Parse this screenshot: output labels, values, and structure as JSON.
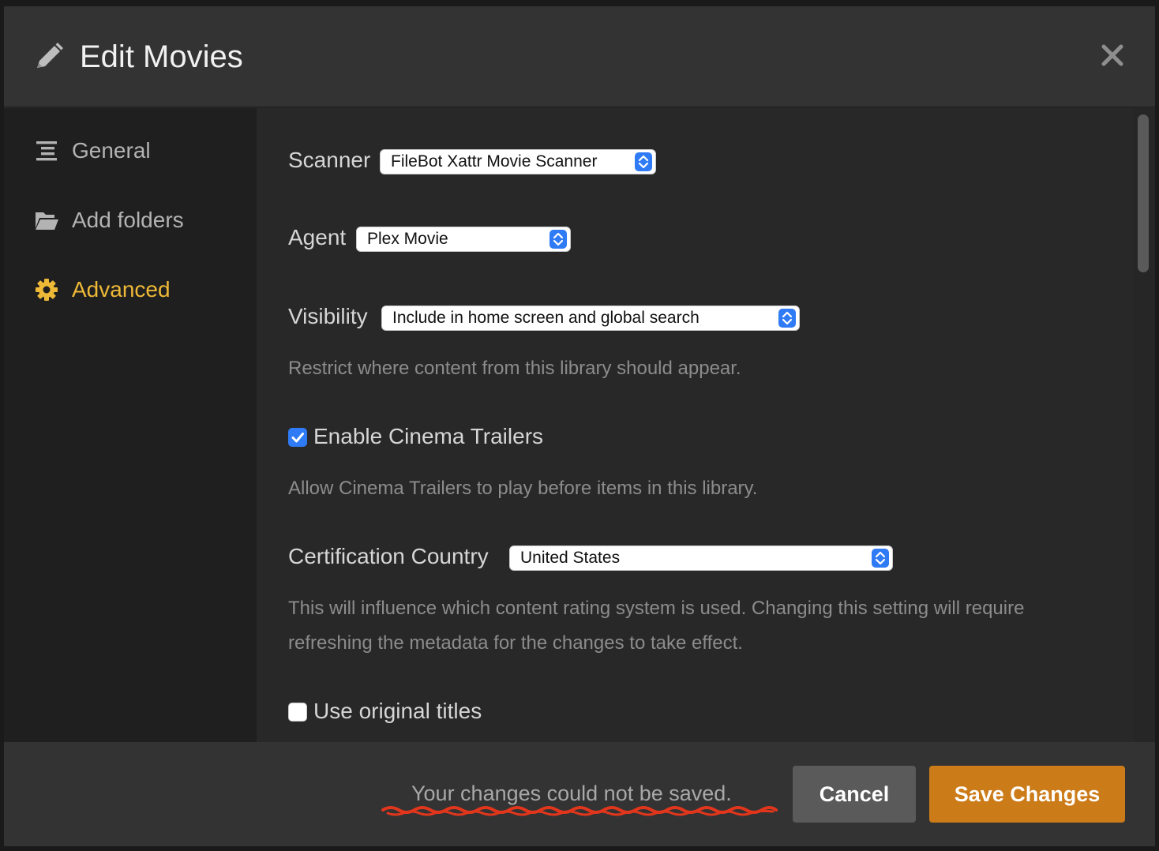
{
  "dialog": {
    "title": "Edit Movies",
    "title_icon": "pencil-icon",
    "close_icon": "close-icon"
  },
  "sidebar": {
    "items": [
      {
        "label": "General",
        "icon": "list-icon",
        "active": false
      },
      {
        "label": "Add folders",
        "icon": "folder-icon",
        "active": false
      },
      {
        "label": "Advanced",
        "icon": "gear-icon",
        "active": true
      }
    ]
  },
  "settings": {
    "scanner": {
      "label": "Scanner",
      "value": "FileBot Xattr Movie Scanner"
    },
    "agent": {
      "label": "Agent",
      "value": "Plex Movie"
    },
    "visibility": {
      "label": "Visibility",
      "value": "Include in home screen and global search",
      "help": "Restrict where content from this library should appear."
    },
    "cinema_trailers": {
      "label": "Enable Cinema Trailers",
      "checked": true,
      "help": "Allow Cinema Trailers to play before items in this library."
    },
    "certification_country": {
      "label": "Certification Country",
      "value": "United States",
      "help": "This will influence which content rating system is used. Changing this setting will require refreshing the metadata for the changes to take effect."
    },
    "original_titles": {
      "label": "Use original titles",
      "checked": false
    }
  },
  "footer": {
    "error": "Your changes could not be saved.",
    "cancel_label": "Cancel",
    "save_label": "Save Changes"
  },
  "colors": {
    "accent": "#eeb937",
    "save_button": "#cc7b19",
    "select_stepper": "#2f7bf5",
    "annotation": "#e2361c"
  }
}
